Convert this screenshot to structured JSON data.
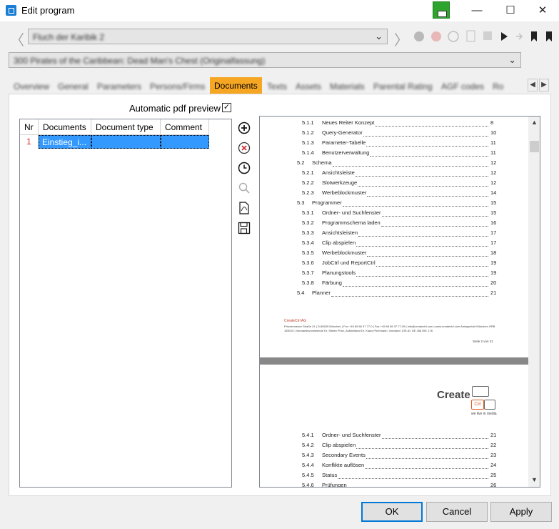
{
  "window": {
    "title": "Edit program",
    "minimize": "—",
    "maximize": "☐",
    "close": "✕"
  },
  "toolbar": {
    "program_combo": "Fluch der Karibik 2",
    "episode_combo": "300 Pirates of the Caribbean: Dead Man's Chest (Originalfassung)",
    "back_glyph": "〈",
    "forward_glyph": "〉"
  },
  "tabs": [
    {
      "label": "Overview",
      "active": false
    },
    {
      "label": "General",
      "active": false
    },
    {
      "label": "Parameters",
      "active": false
    },
    {
      "label": "Persons/Firms",
      "active": false
    },
    {
      "label": "Documents",
      "active": true
    },
    {
      "label": "Texts",
      "active": false
    },
    {
      "label": "Assets",
      "active": false
    },
    {
      "label": "Materials",
      "active": false
    },
    {
      "label": "Parental Rating",
      "active": false
    },
    {
      "label": "AGF codes",
      "active": false
    },
    {
      "label": "Ro",
      "active": false
    }
  ],
  "tab_scroll": {
    "left": "◀",
    "right": "▶"
  },
  "documents": {
    "auto_preview_label": "Automatic pdf preview",
    "auto_preview_checked": true,
    "check_glyph": "✓",
    "columns": [
      "Nr",
      "Documents",
      "Document type",
      "Comment"
    ],
    "rows": [
      {
        "nr": "1",
        "document": "Einstieg_i...",
        "type": "",
        "comment": ""
      }
    ]
  },
  "preview": {
    "toc_page1": [
      {
        "num": "5.1.1",
        "text": "Neues Reiter Konzept",
        "page": "8",
        "level": 3
      },
      {
        "num": "5.1.2",
        "text": "Query-Generator",
        "page": "10",
        "level": 3
      },
      {
        "num": "5.1.3",
        "text": "Parameter-Tabelle",
        "page": "11",
        "level": 3
      },
      {
        "num": "5.1.4",
        "text": "Benutzerverwaltung",
        "page": "11",
        "level": 3
      },
      {
        "num": "5.2",
        "text": "Schema",
        "page": "12",
        "level": 2
      },
      {
        "num": "5.2.1",
        "text": "Ansichtsleiste",
        "page": "12",
        "level": 3
      },
      {
        "num": "5.2.2",
        "text": "Slotwerkzeuge",
        "page": "12",
        "level": 3
      },
      {
        "num": "5.2.3",
        "text": "Werbeblockmuster",
        "page": "14",
        "level": 3
      },
      {
        "num": "5.3",
        "text": "Programmer",
        "page": "15",
        "level": 2
      },
      {
        "num": "5.3.1",
        "text": "Ordner- und Suchfenster",
        "page": "15",
        "level": 3
      },
      {
        "num": "5.3.2",
        "text": "Programmschema laden",
        "page": "16",
        "level": 3
      },
      {
        "num": "5.3.3",
        "text": "Ansichtsleisten",
        "page": "17",
        "level": 3
      },
      {
        "num": "5.3.4",
        "text": "Clip abspielen",
        "page": "17",
        "level": 3
      },
      {
        "num": "5.3.5",
        "text": "Werbeblockmuster",
        "page": "18",
        "level": 3
      },
      {
        "num": "5.3.6",
        "text": "JobCtrl und ReportCtrl",
        "page": "19",
        "level": 3
      },
      {
        "num": "5.3.7",
        "text": "Planungstools",
        "page": "19",
        "level": 3
      },
      {
        "num": "5.3.8",
        "text": "Färbung",
        "page": "20",
        "level": 3
      },
      {
        "num": "5.4",
        "text": "Planner",
        "page": "21",
        "level": 2
      }
    ],
    "footer_brand": "CreateCtrl AG",
    "footer_text": "Prinzenmeuer Straße 21 | D-80639 München | Fon +49 89 66 37 77-0 | Fax +49 89 66 37 77-99 | info@createctrl.com | www.createctrl.com Amtsgericht München HRB 165010 | Vorstandsvorsitzende Dr. Stefan Prinz, Aufsichtsrat Dr. Klaus Pirchmann, Vorstand: USt-ID: DE 256 891 178",
    "page_label": "Seite 2 von 21",
    "logo_word": "Create",
    "logo_ctrl": "Ctrl",
    "logo_tagline": "we live in media",
    "toc_page2": [
      {
        "num": "5.4.1",
        "text": "Ordner- und Suchfenster",
        "page": "21",
        "level": 3
      },
      {
        "num": "5.4.2",
        "text": "Clip abspielen",
        "page": "22",
        "level": 3
      },
      {
        "num": "5.4.3",
        "text": "Secondary Events",
        "page": "23",
        "level": 3
      },
      {
        "num": "5.4.4",
        "text": "Konflikte auflösen",
        "page": "24",
        "level": 3
      },
      {
        "num": "5.4.5",
        "text": "Status",
        "page": "25",
        "level": 3
      },
      {
        "num": "5.4.6",
        "text": "Prüfungen",
        "page": "26",
        "level": 3
      }
    ],
    "scroll_up": "▲",
    "scroll_down": "▼"
  },
  "buttons": {
    "ok": "OK",
    "cancel": "Cancel",
    "apply": "Apply"
  }
}
